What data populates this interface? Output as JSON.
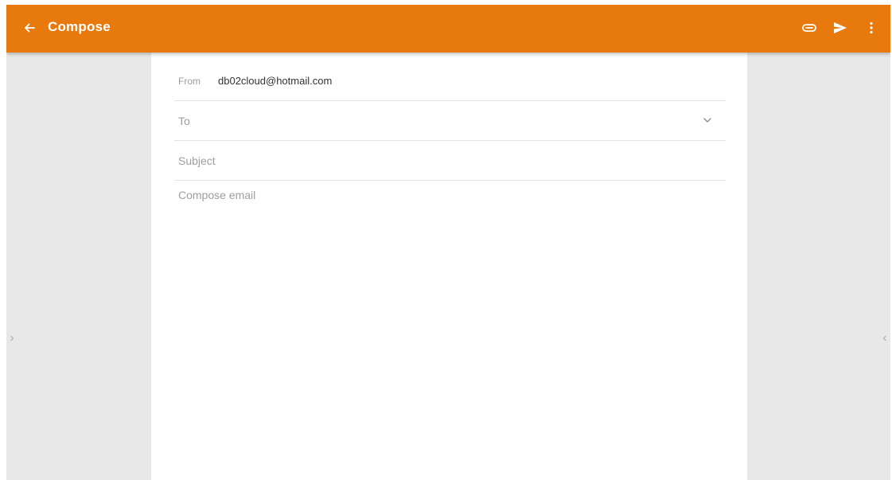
{
  "appbar": {
    "title": "Compose",
    "background": "#e8790c",
    "back_icon": "arrow-left-icon",
    "actions": [
      "attachment-icon",
      "send-icon",
      "more-vert-icon"
    ]
  },
  "form": {
    "from_label": "From",
    "from_value": "db02cloud@hotmail.com",
    "to_placeholder": "To",
    "to_value": "",
    "subject_placeholder": "Subject",
    "subject_value": "",
    "body_placeholder": "Compose email",
    "body_value": ""
  },
  "icons": {
    "to_expand": "chevron-down-icon",
    "left_edge": "chevron-right-icon",
    "right_edge": "chevron-left-icon"
  }
}
